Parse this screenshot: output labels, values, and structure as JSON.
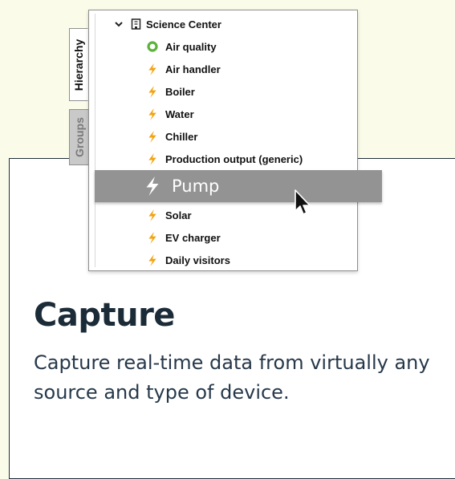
{
  "tabs": {
    "hierarchy_label": "Hierarchy",
    "groups_label": "Groups"
  },
  "tree": {
    "root_label": "Science Center",
    "items": [
      {
        "label": "Air quality",
        "icon": "green-ring-icon"
      },
      {
        "label": "Air handler",
        "icon": "lightning-bolt-icon"
      },
      {
        "label": "Boiler",
        "icon": "lightning-bolt-icon"
      },
      {
        "label": "Water",
        "icon": "lightning-bolt-icon"
      },
      {
        "label": "Chiller",
        "icon": "lightning-bolt-icon"
      },
      {
        "label": "Production output (generic)",
        "icon": "lightning-bolt-icon"
      },
      {
        "label": "Solar",
        "icon": "lightning-bolt-icon"
      },
      {
        "label": "EV charger",
        "icon": "lightning-bolt-icon"
      },
      {
        "label": "Daily visitors",
        "icon": "lightning-bolt-icon"
      }
    ]
  },
  "dragged_item": {
    "label": "Pump",
    "icon": "lightning-bolt-icon"
  },
  "card": {
    "title": "Capture",
    "description": "Capture real-time data from virtually any source and type of device."
  },
  "colors": {
    "background": "#fbfbe9",
    "bolt_orange": "#f2a30f",
    "ring_green": "#5cb23a",
    "drag_row_gray": "#939393",
    "title_navy": "#1b2b38"
  }
}
